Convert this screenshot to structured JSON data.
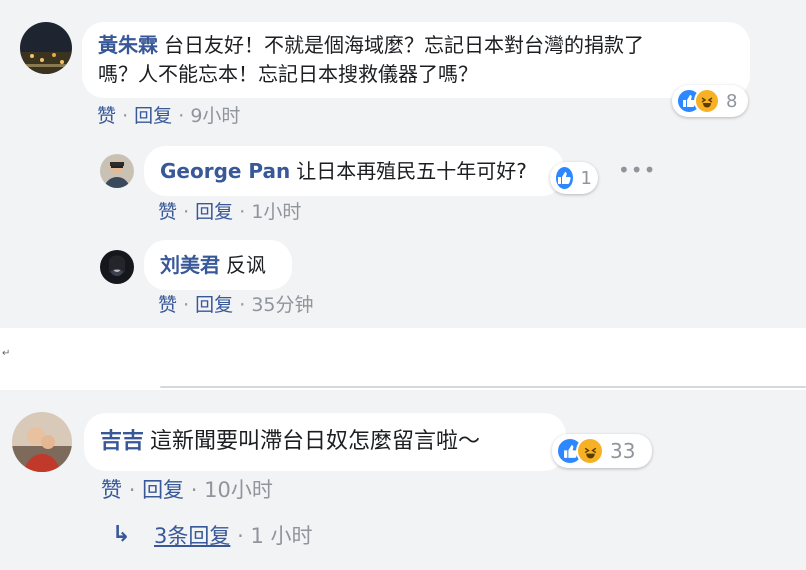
{
  "comments": [
    {
      "author": "黃朱霖",
      "text_line1": "台日友好！不就是個海域麼？忘記日本對台灣的捐款了",
      "text_line2": "嗎？人不能忘本！忘記日本搜救儀器了嗎？",
      "like_label": "赞",
      "reply_label": "回复",
      "time": "9小时",
      "reaction_count": "8"
    },
    {
      "author": "George Pan",
      "text": "让日本再殖民五十年可好?",
      "like_label": "赞",
      "reply_label": "回复",
      "time": "1小时",
      "reaction_count": "1"
    },
    {
      "author": "刘美君",
      "text": "反讽",
      "like_label": "赞",
      "reply_label": "回复",
      "time": "35分钟"
    },
    {
      "author": "吉吉",
      "text": "這新聞要叫滯台日奴怎麼留言啦～",
      "like_label": "赞",
      "reply_label": "回复",
      "time": "10小时",
      "reaction_count": "33"
    }
  ],
  "replies_link": {
    "label": "3条回复",
    "time": "1 小时"
  },
  "separator": "·",
  "more_glyph": "•••",
  "reply_arrow_glyph": "↳",
  "gap_mark": "↵",
  "colors": {
    "panel": "#f2f3f5",
    "name": "#385898",
    "like": "#2d88ff",
    "haha": "#f7b125",
    "muted": "#90949c"
  }
}
